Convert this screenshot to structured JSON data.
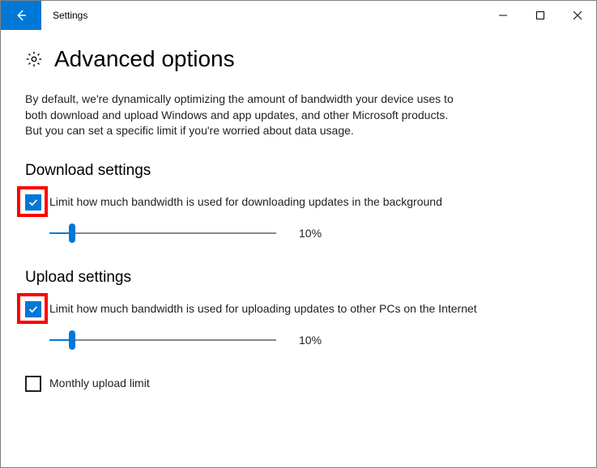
{
  "window": {
    "title": "Settings"
  },
  "page": {
    "heading": "Advanced options",
    "intro": "By default, we're dynamically optimizing the amount of bandwidth your device uses to both download and upload Windows and app updates, and other Microsoft products. But you can set a specific limit if you're worried about data usage."
  },
  "download": {
    "title": "Download settings",
    "checkbox_label": "Limit how much bandwidth is used for downloading updates in the background",
    "checked": true,
    "slider_percent": 10,
    "slider_label": "10%"
  },
  "upload": {
    "title": "Upload settings",
    "checkbox_label": "Limit how much bandwidth is used for uploading updates to other PCs on the Internet",
    "checked": true,
    "slider_percent": 10,
    "slider_label": "10%",
    "monthly_limit_label": "Monthly upload limit",
    "monthly_limit_checked": false
  },
  "colors": {
    "accent": "#0078d7",
    "highlight": "#ff0000"
  }
}
